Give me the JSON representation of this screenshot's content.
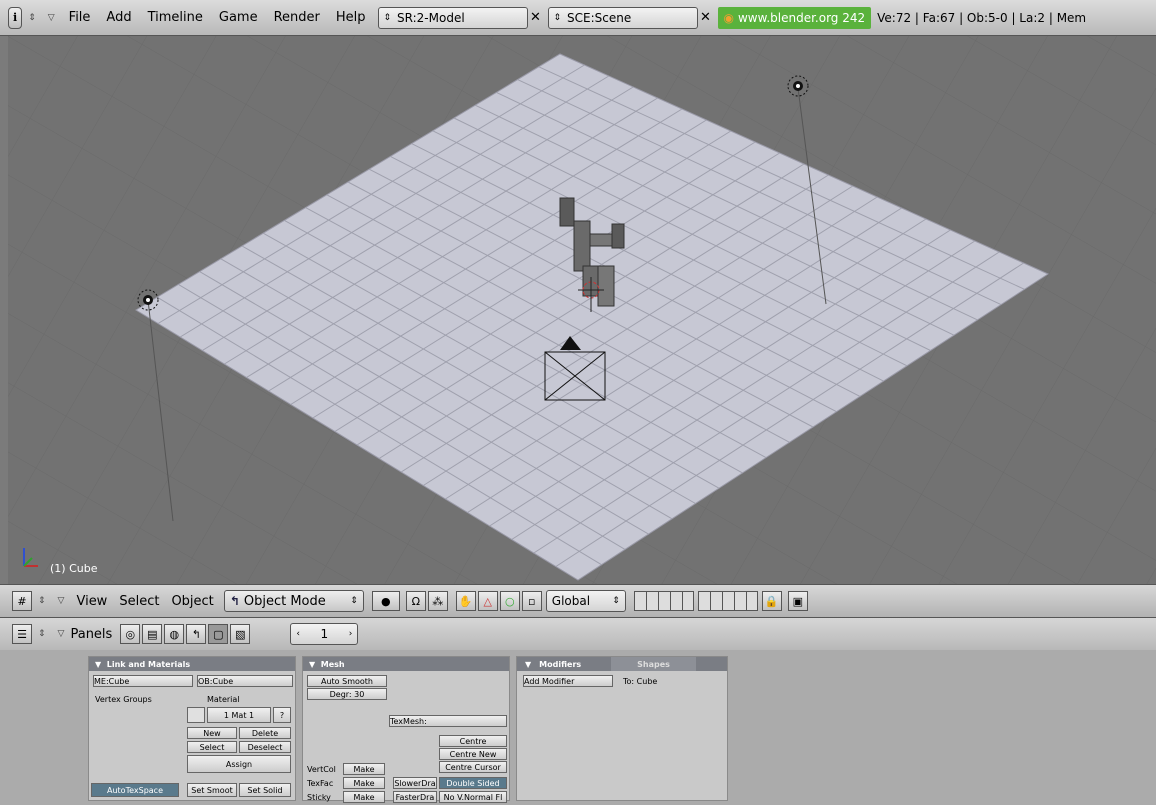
{
  "topbar": {
    "info_icon": "info-icon",
    "menus": [
      "File",
      "Add",
      "Timeline",
      "Game",
      "Render",
      "Help"
    ],
    "screen": "SR:2-Model",
    "scene": "SCE:Scene",
    "version": "www.blender.org 242",
    "stats": "Ve:72 | Fa:67 | Ob:5-0 | La:2 | Mem"
  },
  "viewport": {
    "object_label": "(1) Cube"
  },
  "view_header": {
    "menus": [
      "View",
      "Select",
      "Object"
    ],
    "mode": "Object Mode",
    "orientation": "Global"
  },
  "buttons_header": {
    "label": "Panels",
    "frame": "1"
  },
  "link_panel": {
    "title": "Link and Materials",
    "me": "ME:Cube",
    "ob": "OB:Cube",
    "vertex_groups": "Vertex Groups",
    "material": "Material",
    "mat": "1 Mat 1",
    "new": "New",
    "delete": "Delete",
    "select": "Select",
    "deselect": "Deselect",
    "assign": "Assign",
    "autotex": "AutoTexSpace",
    "set_smooth": "Set Smoot",
    "set_solid": "Set Solid"
  },
  "mesh_panel": {
    "title": "Mesh",
    "auto_smooth": "Auto Smooth",
    "degr": "Degr: 30",
    "texmesh": "TexMesh:",
    "centre": "Centre",
    "centre_new": "Centre New",
    "centre_cursor": "Centre Cursor",
    "vertcol": "VertCol",
    "texface": "TexFac",
    "sticky": "Sticky",
    "make": "Make",
    "slower": "SlowerDra",
    "faster": "FasterDra",
    "double_sided": "Double Sided",
    "no_vnormal": "No V.Normal Fl"
  },
  "modifiers_panel": {
    "tab1": "Modifiers",
    "tab2": "Shapes",
    "add": "Add Modifier",
    "to": "To: Cube"
  }
}
